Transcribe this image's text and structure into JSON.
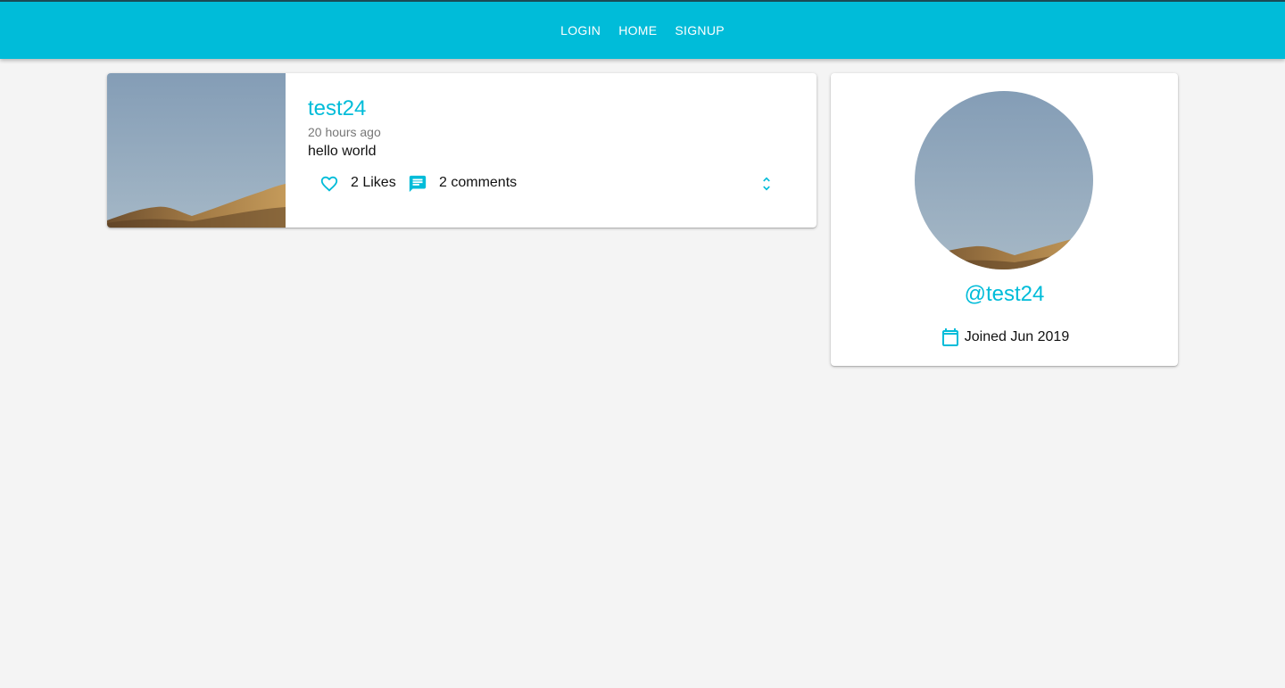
{
  "nav": {
    "items": [
      "LOGIN",
      "HOME",
      "SIGNUP"
    ]
  },
  "post": {
    "username": "test24",
    "time": "20 hours ago",
    "body": "hello world",
    "likes_label": "2 Likes",
    "comments_label": "2 comments",
    "icons": {
      "like": "heart-outline-icon",
      "comment": "comment-icon",
      "expand": "unfold-more-icon"
    }
  },
  "profile": {
    "handle": "@test24",
    "joined": "Joined Jun 2019",
    "icons": {
      "calendar": "calendar-icon"
    }
  },
  "colors": {
    "primary": "#00bcd9",
    "background": "#f4f4f4",
    "card": "#ffffff",
    "muted_text": "#777777"
  }
}
